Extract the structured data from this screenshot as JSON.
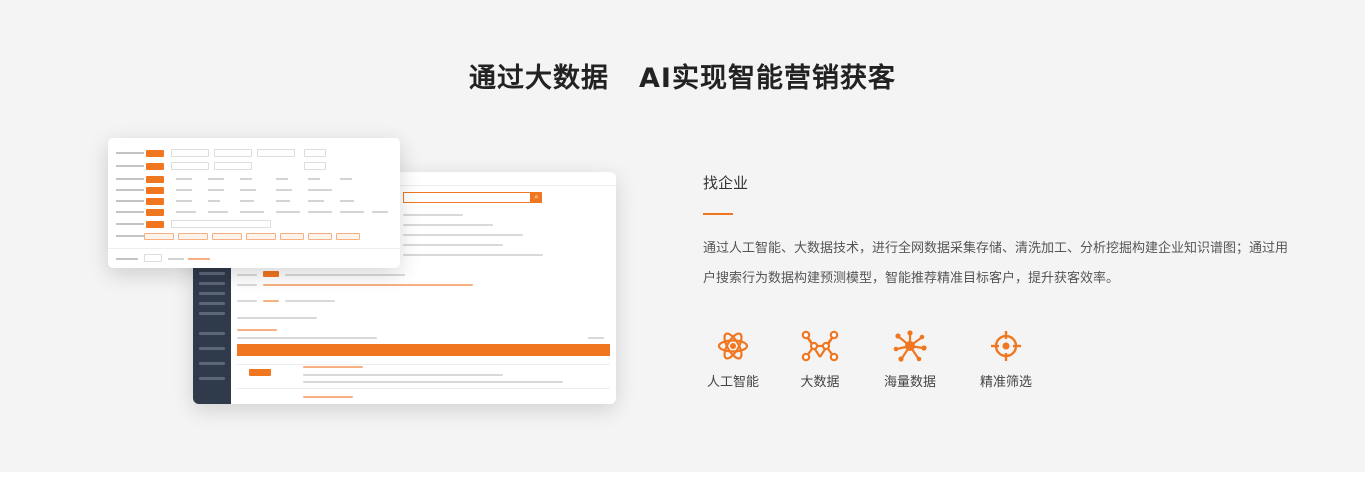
{
  "headline": {
    "part1": "通过大数据",
    "part2": "AI实现智能营销获客"
  },
  "section": {
    "title": "找企业",
    "description": "通过人工智能、大数据技术，进行全网数据采集存储、清洗加工、分析挖掘构建企业知识谱图；通过用户搜索行为数据构建预测模型，智能推荐精准目标客户，提升获客效率。"
  },
  "features": [
    {
      "label": "人工智能",
      "icon": "atom-icon"
    },
    {
      "label": "大数据",
      "icon": "network-nodes-icon"
    },
    {
      "label": "海量数据",
      "icon": "data-burst-icon"
    },
    {
      "label": "精准筛选",
      "icon": "target-crosshair-icon"
    }
  ],
  "colors": {
    "accent": "#f07620",
    "background": "#f4f4f4",
    "sidebar": "#2f3a4b"
  }
}
